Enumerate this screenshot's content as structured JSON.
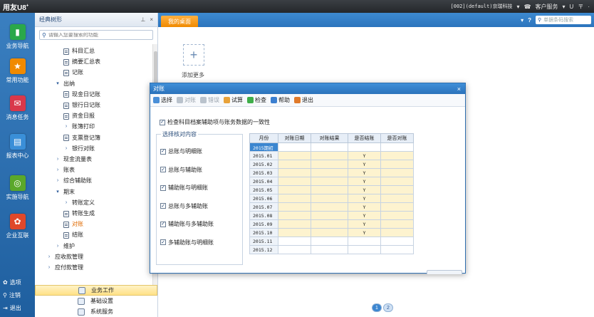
{
  "titlebar": {
    "brand": "用友U8",
    "brand_sup": "+",
    "account": "[002](default)京瑞科技",
    "service": "客户服务",
    "extra": "U",
    "min": "〒"
  },
  "nav": {
    "items": [
      {
        "label": "业务导航",
        "color": "#2aa84a"
      },
      {
        "label": "常用功能",
        "color": "#f08a00"
      },
      {
        "label": "消息任务",
        "color": "#d9384a"
      },
      {
        "label": "报表中心",
        "color": "#3a8fd8"
      },
      {
        "label": "实施导航",
        "color": "#5aa82a"
      },
      {
        "label": "企业互联",
        "color": "#e0482a"
      }
    ],
    "bottom": [
      {
        "label": "选项"
      },
      {
        "label": "注销"
      },
      {
        "label": "退出"
      }
    ]
  },
  "tree": {
    "title": "经典树形",
    "search_placeholder": "请输入您要搜索的功能",
    "rows": [
      {
        "label": "科目汇总",
        "kind": "doc"
      },
      {
        "label": "摘要汇总表",
        "kind": "doc"
      },
      {
        "label": "记账",
        "kind": "doc"
      },
      {
        "label": "出纳",
        "kind": "open"
      },
      {
        "label": "现金日记账",
        "kind": "doc"
      },
      {
        "label": "银行日记账",
        "kind": "doc"
      },
      {
        "label": "资金日报",
        "kind": "doc"
      },
      {
        "label": "账簿打印",
        "kind": "closed"
      },
      {
        "label": "支票登记簿",
        "kind": "doc"
      },
      {
        "label": "银行对账",
        "kind": "closed"
      },
      {
        "label": "现金流量表",
        "kind": "closed"
      },
      {
        "label": "账表",
        "kind": "closed"
      },
      {
        "label": "综合辅助账",
        "kind": "closed"
      },
      {
        "label": "期末",
        "kind": "open"
      },
      {
        "label": "转账定义",
        "kind": "closed"
      },
      {
        "label": "转账生成",
        "kind": "doc"
      },
      {
        "label": "对账",
        "kind": "doc"
      },
      {
        "label": "结账",
        "kind": "doc"
      },
      {
        "label": "维护",
        "kind": "closed"
      },
      {
        "label": "应收款管理",
        "kind": "closed"
      },
      {
        "label": "应付款管理",
        "kind": "closed"
      }
    ],
    "bottom": [
      {
        "label": "业务工作"
      },
      {
        "label": "基础设置"
      },
      {
        "label": "系统服务"
      }
    ]
  },
  "workspace": {
    "tab": "我的桌面",
    "search_placeholder": "单据条码搜索",
    "add_label": "添加更多",
    "pages": [
      "1",
      "2"
    ]
  },
  "dialog": {
    "title": "对账",
    "close": "×",
    "toolbar": [
      {
        "label": "选择",
        "enabled": true,
        "icon": "select-icon"
      },
      {
        "label": "对账",
        "enabled": false,
        "icon": "reconcile-icon"
      },
      {
        "label": "错误",
        "enabled": false,
        "icon": "error-icon"
      },
      {
        "label": "试算",
        "enabled": true,
        "icon": "trial-icon"
      },
      {
        "label": "检查",
        "enabled": true,
        "icon": "check-icon"
      },
      {
        "label": "帮助",
        "enabled": true,
        "icon": "help-icon"
      },
      {
        "label": "退出",
        "enabled": true,
        "icon": "exit-icon"
      }
    ],
    "top_check": "检查科目档案辅助项与账务数据的一致性",
    "group_title": "选择核对内容",
    "options": [
      "总账与明细账",
      "总账与辅助账",
      "辅助账与明细账",
      "总账与多辅助账",
      "辅助账与多辅助账",
      "多辅助账与明细账"
    ],
    "table": {
      "headers": [
        "月份",
        "对账日期",
        "对账结果",
        "是否结账",
        "是否对账"
      ],
      "rows": [
        {
          "month": "2015期初",
          "closed": "",
          "period": false,
          "selected": true
        },
        {
          "month": "2015.01",
          "closed": "Y",
          "period": true
        },
        {
          "month": "2015.02",
          "closed": "Y",
          "period": true
        },
        {
          "month": "2015.03",
          "closed": "Y",
          "period": true
        },
        {
          "month": "2015.04",
          "closed": "Y",
          "period": true
        },
        {
          "month": "2015.05",
          "closed": "Y",
          "period": true
        },
        {
          "month": "2015.06",
          "closed": "Y",
          "period": true
        },
        {
          "month": "2015.07",
          "closed": "Y",
          "period": true
        },
        {
          "month": "2015.08",
          "closed": "Y",
          "period": true
        },
        {
          "month": "2015.09",
          "closed": "Y",
          "period": true
        },
        {
          "month": "2015.10",
          "closed": "Y",
          "period": true
        },
        {
          "month": "2015.11",
          "closed": "",
          "period": false
        },
        {
          "month": "2015.12",
          "closed": "",
          "period": false
        }
      ]
    }
  }
}
